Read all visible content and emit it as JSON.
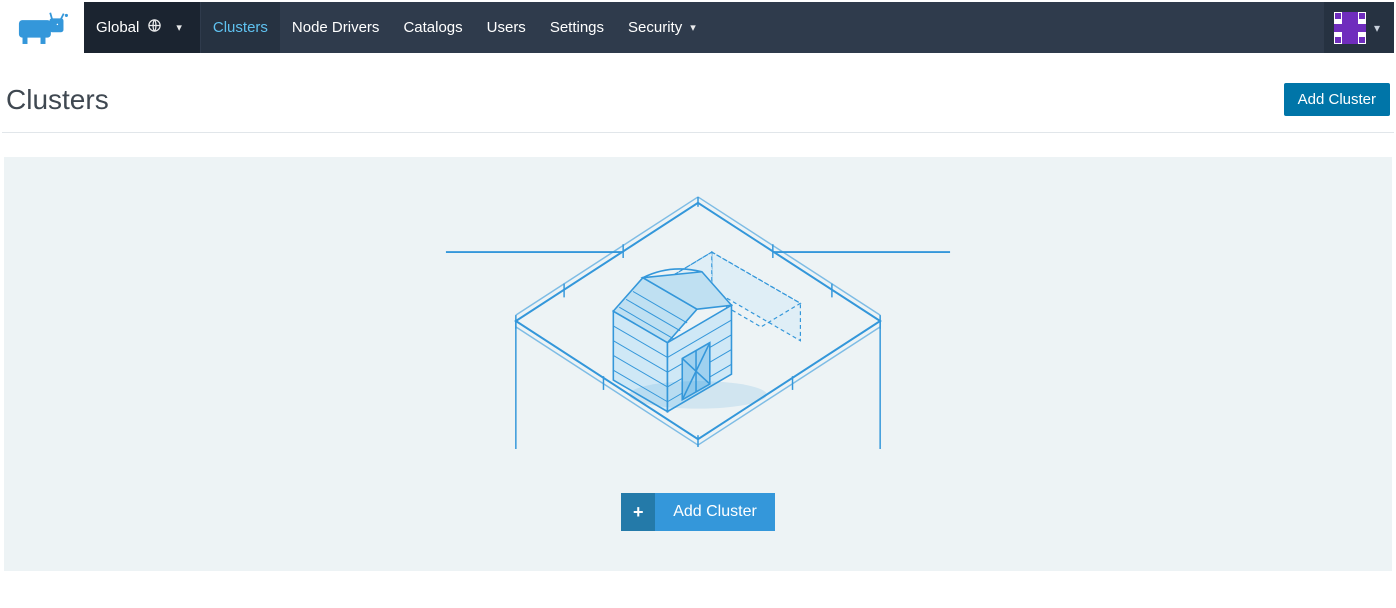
{
  "nav": {
    "scope_label": "Global",
    "items": [
      {
        "label": "Clusters",
        "active": true
      },
      {
        "label": "Node Drivers",
        "active": false
      },
      {
        "label": "Catalogs",
        "active": false
      },
      {
        "label": "Users",
        "active": false
      },
      {
        "label": "Settings",
        "active": false
      },
      {
        "label": "Security",
        "active": false,
        "has_dropdown": true
      }
    ]
  },
  "page": {
    "title": "Clusters",
    "add_button_label": "Add Cluster"
  },
  "empty_state": {
    "add_button_label": "Add Cluster",
    "plus_glyph": "+"
  },
  "colors": {
    "brand_blue": "#3497da",
    "nav_bg": "#2f3b4c",
    "nav_active_text": "#5fc2f0",
    "panel_bg": "#edf3f5",
    "primary_button": "#0075a8",
    "avatar_purple": "#6f2dbd"
  }
}
